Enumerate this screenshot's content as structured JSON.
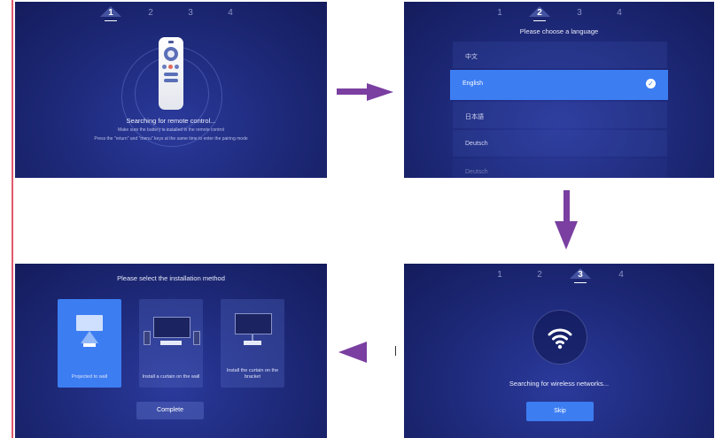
{
  "steps": [
    "1",
    "2",
    "3",
    "4"
  ],
  "remote_screen": {
    "title": "Searching for remote control...",
    "hint1": "Make sure the battery is installed in the remote control",
    "hint2": "Press the \"return\" and \"menu\" keys at the same time to enter the pairing mode",
    "active_step": 1
  },
  "language_screen": {
    "title": "Please choose a language",
    "active_step": 2,
    "options": [
      "中文",
      "English",
      "日本語",
      "Deutsch",
      "Deutsch"
    ],
    "selected": "English"
  },
  "wifi_screen": {
    "title": "Searching for wireless networks...",
    "active_step": 3,
    "skip_label": "Skip"
  },
  "install_screen": {
    "title": "Please select the installation method",
    "options": [
      {
        "label": "Projected to wall"
      },
      {
        "label": "Install a curtain on the wall"
      },
      {
        "label": "Install the curtain on the bracket"
      }
    ],
    "complete_label": "Complete"
  },
  "colors": {
    "accent": "#3c7df2",
    "panel_bg": "#1f2b7d",
    "arrow": "#7a3fa1"
  },
  "icons": [
    "remote-control-icon",
    "check-icon",
    "wifi-icon",
    "projector-icon",
    "speaker-icon"
  ]
}
